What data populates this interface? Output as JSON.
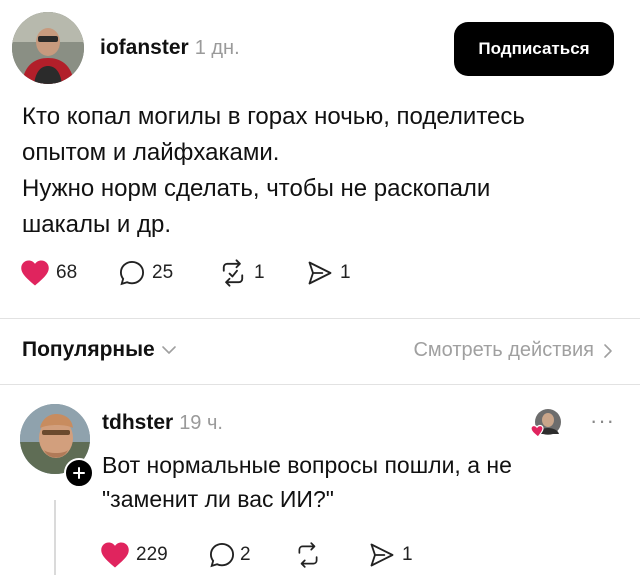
{
  "post": {
    "author": "iofanster",
    "time": "1 дн.",
    "subscribe_label": "Подписаться",
    "text_lines": [
      "Кто копал могилы в горах ночью, поделитесь",
      "опытом и лайфхаками.",
      "Нужно норм сделать, чтобы не раскопали",
      "шакалы и др."
    ],
    "likes": "68",
    "comments": "25",
    "reposts": "1",
    "shares": "1"
  },
  "replies_bar": {
    "sort_label": "Популярные",
    "view_actions_label": "Смотреть действия"
  },
  "comment": {
    "author": "tdhster",
    "time": "19 ч.",
    "more_label": "···",
    "text_lines": [
      "Вот нормальные вопросы пошли, а не",
      "\"заменит ли вас ИИ?\""
    ],
    "likes": "229",
    "comments": "2",
    "shares": "1"
  },
  "colors": {
    "heart": "#e0245e",
    "button_bg": "#000000",
    "muted": "#9a9a9a"
  }
}
